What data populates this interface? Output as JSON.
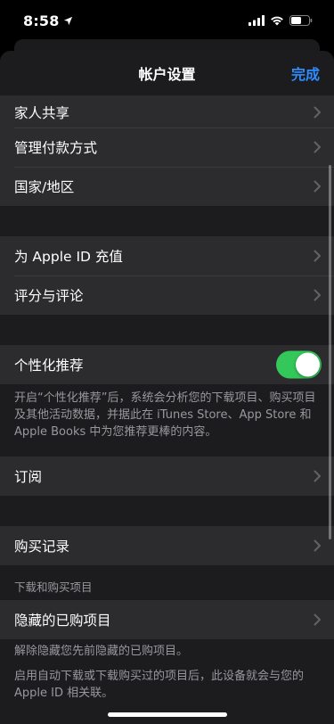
{
  "status_bar": {
    "time": "8:58"
  },
  "nav": {
    "title": "帐户设置",
    "done_label": "完成"
  },
  "group1": {
    "items": [
      {
        "label": "家人共享"
      },
      {
        "label": "管理付款方式"
      },
      {
        "label": "国家/地区"
      }
    ]
  },
  "group2": {
    "items": [
      {
        "label": "为 Apple ID 充值"
      },
      {
        "label": "评分与评论"
      }
    ]
  },
  "personalization": {
    "label": "个性化推荐",
    "enabled": true,
    "toggle_color": "#34c759",
    "footer": "开启“个性化推荐”后，系统会分析您的下载项目、购买项目及其他活动数据，并据此在 iTunes Store、App Store 和 Apple Books 中为您推荐更棒的内容。"
  },
  "subscriptions": {
    "label": "订阅"
  },
  "purchase_history": {
    "label": "购买记录"
  },
  "downloads": {
    "header": "下载和购买项目",
    "hidden_label": "隐藏的已购项目",
    "hidden_footer": "解除隐藏您先前隐藏的已购项目。",
    "auto_footer": "启用自动下载或下载购买过的项目后，此设备就会与您的 Apple ID 相关联。"
  },
  "icons": {
    "location": "location-arrow-icon",
    "signal": "cellular-signal-icon",
    "wifi": "wifi-icon",
    "battery": "battery-icon",
    "chevron": "chevron-right-icon"
  },
  "colors": {
    "accent": "#2f8cff",
    "background": "#1c1c1e",
    "cell": "#2c2c2e"
  }
}
